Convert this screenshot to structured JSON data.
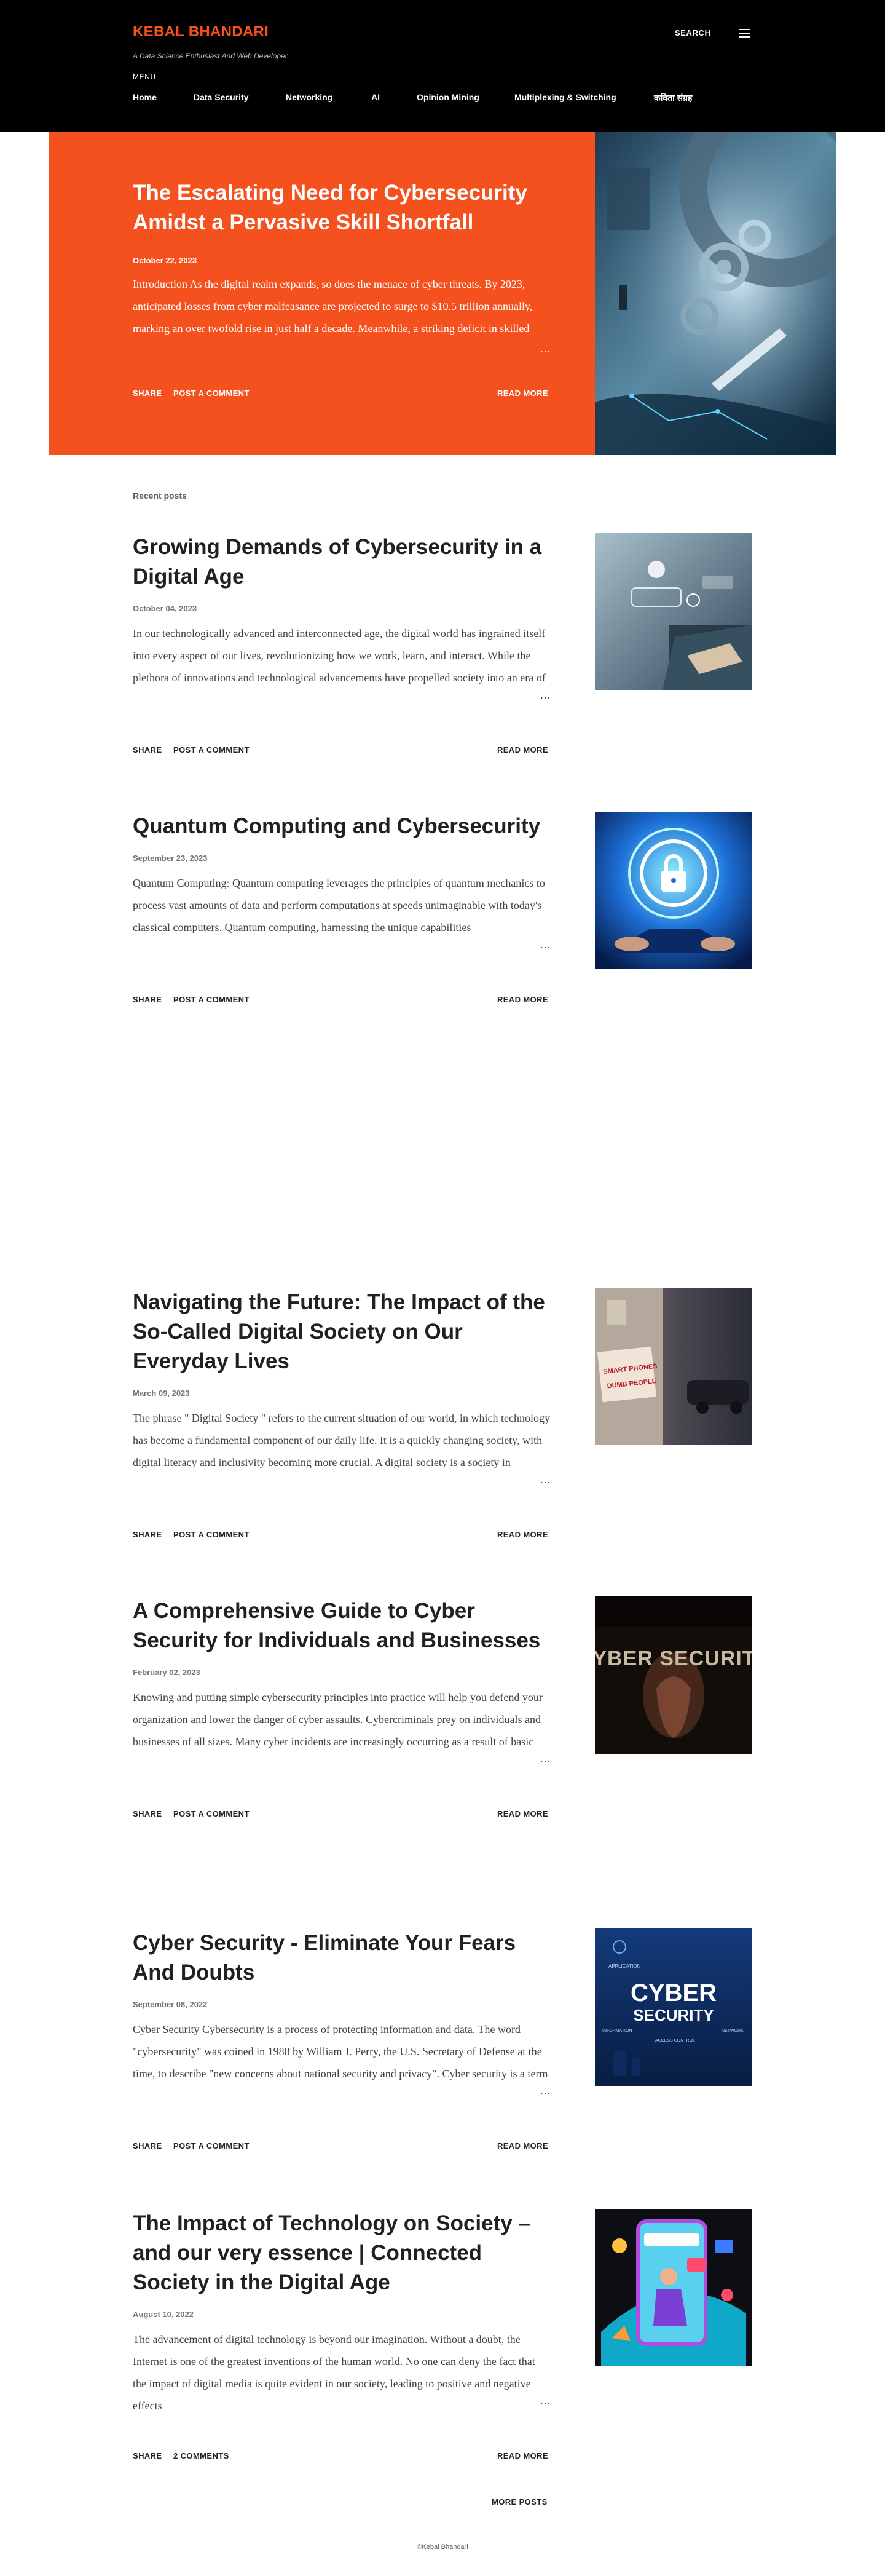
{
  "header": {
    "blog_title": "KEBAL BHANDARI",
    "blog_description": "A Data Science Enthusiast And Web Developer.",
    "menu_label": "MENU",
    "search_label": "SEARCH",
    "nav": [
      "Home",
      "Data Security",
      "Networking",
      "AI",
      "Opinion Mining",
      "Multiplexing & Switching",
      "कविता संग्रह"
    ]
  },
  "featured": {
    "title": "The Escalating Need for Cybersecurity Amidst a Pervasive Skill Shortfall",
    "date": "October 22, 2023",
    "snippet": "Introduction As the digital realm expands, so does the menace of cyber threats. By 2023, anticipated losses from cyber malfeasance are projected to surge to $10.5 trillion annually, marking an over twofold rise in just half a decade. Meanwhile, a striking deficit in skilled",
    "ellipsis": "…",
    "share": "SHARE",
    "comment": "POST A COMMENT",
    "read_more": "READ MORE"
  },
  "recent_label": "Recent posts",
  "posts": [
    {
      "title": "Growing Demands of Cybersecurity in a Digital Age",
      "date": "October 04, 2023",
      "snippet": "In our technologically advanced and interconnected age, the digital world has ingrained itself into every aspect of our lives, revolutionizing how we work, learn, and interact. While the plethora of innovations and technological advancements have propelled society into an era of",
      "ellipsis": "…",
      "share": "SHARE",
      "comment": "POST A COMMENT",
      "read_more": "READ MORE"
    },
    {
      "title": "Quantum Computing and Cybersecurity",
      "date": "September 23, 2023",
      "snippet": "Quantum Computing: Quantum computing leverages the principles of quantum mechanics to process vast amounts of data and perform computations at speeds unimaginable with today's classical computers. Quantum computing, harnessing the unique capabilities",
      "ellipsis": "…",
      "share": "SHARE",
      "comment": "POST A COMMENT",
      "read_more": "READ MORE"
    },
    {
      "title": "Navigating the Future: The Impact of the So-Called Digital Society on Our Everyday Lives",
      "date": "March 09, 2023",
      "snippet": "  The phrase \" Digital Society \" refers to the current situation of our world, in which technology has become a fundamental component of our daily life. It is a quickly changing society, with digital literacy and inclusivity becoming more crucial. A digital society is a society in",
      "ellipsis": "…",
      "share": "SHARE",
      "comment": "POST A COMMENT",
      "read_more": "READ MORE"
    },
    {
      "title": "A Comprehensive Guide to Cyber Security for Individuals and Businesses",
      "date": "February 02, 2023",
      "snippet": "Knowing and putting simple cybersecurity principles into practice will help you defend your organization and lower the danger of cyber assaults. Cybercriminals prey on individuals and businesses of all sizes. Many cyber incidents are increasingly occurring as a result of basic",
      "ellipsis": "…",
      "share": "SHARE",
      "comment": "POST A COMMENT",
      "read_more": "READ MORE"
    },
    {
      "title": "Cyber Security - Eliminate Your Fears And Doubts",
      "date": "September 08, 2022",
      "snippet": " Cyber Security Cybersecurity is a process of protecting information and data. The word \"cybersecurity\" was coined in 1988 by William J. Perry, the U.S. Secretary of Defense at the time, to describe \"new concerns about national security and privacy\". Cyber security is a term",
      "ellipsis": "…",
      "share": "SHARE",
      "comment": "POST A COMMENT",
      "read_more": "READ MORE"
    },
    {
      "title": "The Impact of Technology on Society – and our very essence | Connected Society in the Digital Age",
      "date": "August 10, 2022",
      "snippet": "The advancement of digital technology is beyond our imagination. Without a doubt, the Internet is one of the greatest inventions of the human world. No one can deny the fact that the impact of digital media is quite evident in our society, leading to positive and negative effects",
      "ellipsis": "…",
      "share": "SHARE",
      "comment": "2 COMMENTS",
      "read_more": "READ MORE"
    }
  ],
  "thumb_text": {
    "smart_phones": "SMART PHONES",
    "dumb_people": "DUMB PEOPLE",
    "cyber_security_gold": "CYBER SECURITY",
    "cyber": "CYBER",
    "security": "SECURITY",
    "application": "APPLICATION",
    "information": "INFORMATION",
    "access_control": "ACCESS CONTROL",
    "network": "NETWORK"
  },
  "more_posts": "MORE POSTS",
  "footer": "©Kebal Bhandari",
  "colors": {
    "accent": "#f4511e",
    "header_bg": "#000000",
    "text": "#212121"
  }
}
